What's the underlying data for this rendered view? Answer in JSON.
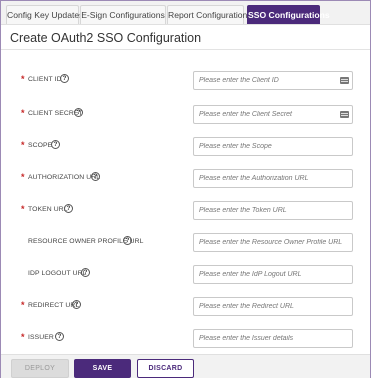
{
  "tabs": [
    {
      "label": "Config Key Updates",
      "active": false
    },
    {
      "label": "E-Sign Configurations",
      "active": false
    },
    {
      "label": "Report Configurations",
      "active": false
    },
    {
      "label": "SSO Configurations",
      "active": true
    }
  ],
  "page": {
    "title": "Create OAuth2 SSO Configuration"
  },
  "form": {
    "fields": [
      {
        "label": "CLIENT ID",
        "required": true,
        "placeholder": "Please enter the Client ID",
        "icon": "keyboard-icon"
      },
      {
        "label": "CLIENT SECRET",
        "required": true,
        "placeholder": "Please enter the Client Secret",
        "icon": "keyboard-icon"
      },
      {
        "label": "SCOPE",
        "required": true,
        "placeholder": "Please enter the Scope"
      },
      {
        "label": "AUTHORIZATION URL",
        "required": true,
        "placeholder": "Please enter the Authorization URL"
      },
      {
        "label": "TOKEN URL",
        "required": true,
        "placeholder": "Please enter the Token URL"
      },
      {
        "label": "RESOURCE OWNER PROFILE URL",
        "required": false,
        "placeholder": "Please enter the Resource Owner Profile URL"
      },
      {
        "label": "IDP LOGOUT URL",
        "required": false,
        "placeholder": "Please enter the IdP Logout URL"
      },
      {
        "label": "REDIRECT URL",
        "required": true,
        "placeholder": "Please enter the Redirect URL"
      },
      {
        "label": "ISSUER",
        "required": true,
        "placeholder": "Please enter the Issuer details"
      }
    ],
    "help_glyph": "?",
    "required_glyph": "*"
  },
  "footer": {
    "deploy_label": "DEPLOY",
    "save_label": "SAVE",
    "discard_label": "DISCARD"
  },
  "colors": {
    "accent": "#4b2a7b",
    "required": "#c62828"
  }
}
